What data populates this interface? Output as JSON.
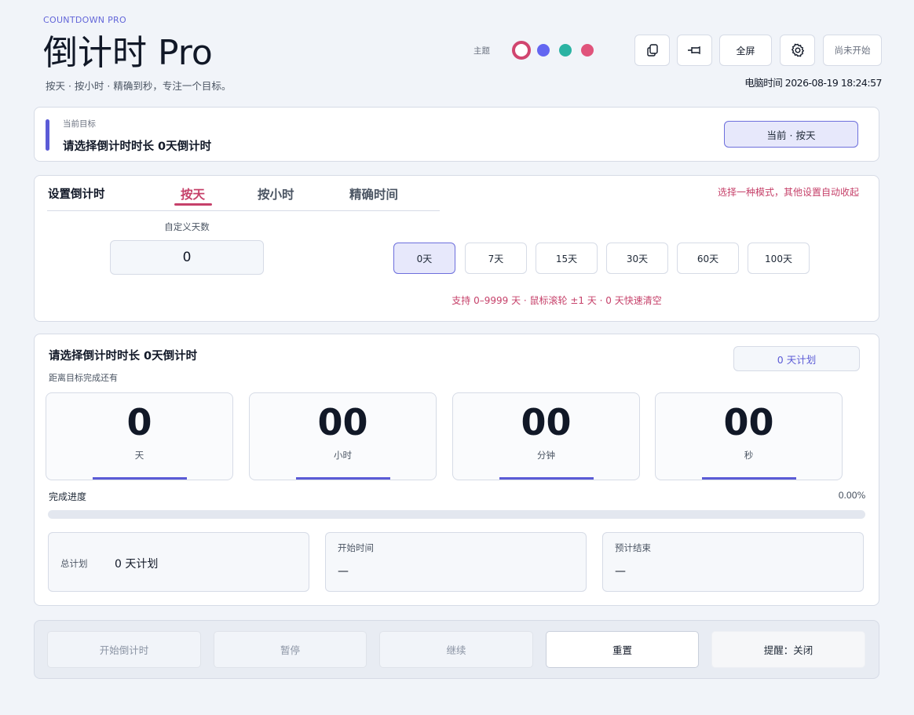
{
  "header": {
    "brand": "COUNTDOWN PRO",
    "title": "倒计时 Pro",
    "subtitle": "按天 · 按小时 · 精确到秒，专注一个目标。",
    "theme_label": "主题",
    "themes": [
      "#d1456f",
      "#6366f1",
      "#2bb3a3",
      "#e0537b"
    ],
    "buttons": {
      "fullscreen": "全屏",
      "status": "尚未开始"
    },
    "clock": "电脑时间  2026-08-19 18:24:57"
  },
  "goal": {
    "label": "当前目标",
    "text": "请选择倒计时时长  0天倒计时",
    "mode": "当前 · 按天"
  },
  "settings": {
    "title": "设置倒计时",
    "tabs": [
      "按天",
      "按小时",
      "精确时间"
    ],
    "active_tab": "按天",
    "hint": "选择一种模式，其他设置自动收起",
    "custom_label": "自定义天数",
    "custom_value": "0",
    "presets": [
      "0天",
      "7天",
      "15天",
      "30天",
      "60天",
      "100天"
    ],
    "active_preset": "0天",
    "support": "支持 0–9999 天 · 鼠标滚轮 ±1 天 · 0 天快速清空"
  },
  "countdown": {
    "title": "请选择倒计时时长  0天倒计时",
    "plan_badge": "0 天计划",
    "subtitle": "距离目标完成还有",
    "units": [
      {
        "value": "0",
        "label": "天"
      },
      {
        "value": "00",
        "label": "小时"
      },
      {
        "value": "00",
        "label": "分钟"
      },
      {
        "value": "00",
        "label": "秒"
      }
    ],
    "progress_label": "完成进度",
    "progress_text": "0.00%",
    "progress_value": 0,
    "info": {
      "total_label": "总计划",
      "total_value": "0 天计划",
      "start_label": "开始时间",
      "start_value": "—",
      "end_label": "预计结束",
      "end_value": "—"
    }
  },
  "controls": {
    "start": "开始倒计时",
    "pause": "暂停",
    "resume": "继续",
    "reset": "重置",
    "reminder": "提醒：关闭"
  }
}
